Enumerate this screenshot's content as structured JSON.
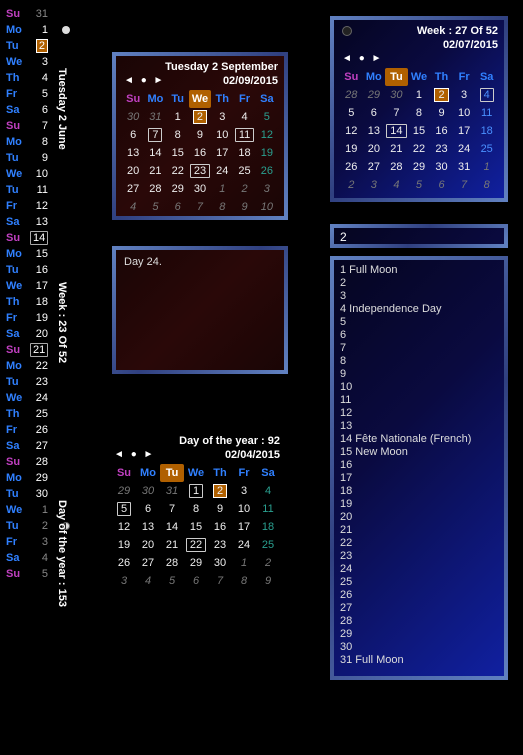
{
  "vertical_list": {
    "label_top": "Tuesday 2 June",
    "label_mid": "Week : 23 Of 52",
    "label_bot": "Day of the year : 153",
    "rows": [
      {
        "dow": "Su",
        "n": "31",
        "cls": "grey"
      },
      {
        "dow": "Mo",
        "n": "1",
        "cls": "white",
        "moon": "full"
      },
      {
        "dow": "Tu",
        "n": "2",
        "cls": "white",
        "mark": "orange"
      },
      {
        "dow": "We",
        "n": "3",
        "cls": "white"
      },
      {
        "dow": "Th",
        "n": "4",
        "cls": "white"
      },
      {
        "dow": "Fr",
        "n": "5",
        "cls": "white"
      },
      {
        "dow": "Sa",
        "n": "6",
        "cls": "white"
      },
      {
        "dow": "Su",
        "n": "7",
        "cls": "white"
      },
      {
        "dow": "Mo",
        "n": "8",
        "cls": "white"
      },
      {
        "dow": "Tu",
        "n": "9",
        "cls": "white"
      },
      {
        "dow": "We",
        "n": "10",
        "cls": "white"
      },
      {
        "dow": "Tu",
        "n": "11",
        "cls": "white"
      },
      {
        "dow": "Fr",
        "n": "12",
        "cls": "white"
      },
      {
        "dow": "Sa",
        "n": "13",
        "cls": "white"
      },
      {
        "dow": "Su",
        "n": "14",
        "cls": "white",
        "mark": "box"
      },
      {
        "dow": "Mo",
        "n": "15",
        "cls": "white"
      },
      {
        "dow": "Tu",
        "n": "16",
        "cls": "white"
      },
      {
        "dow": "We",
        "n": "17",
        "cls": "white"
      },
      {
        "dow": "Th",
        "n": "18",
        "cls": "white"
      },
      {
        "dow": "Fr",
        "n": "19",
        "cls": "white"
      },
      {
        "dow": "Sa",
        "n": "20",
        "cls": "white"
      },
      {
        "dow": "Su",
        "n": "21",
        "cls": "white",
        "mark": "box"
      },
      {
        "dow": "Mo",
        "n": "22",
        "cls": "white"
      },
      {
        "dow": "Tu",
        "n": "23",
        "cls": "white"
      },
      {
        "dow": "We",
        "n": "24",
        "cls": "white"
      },
      {
        "dow": "Th",
        "n": "25",
        "cls": "white"
      },
      {
        "dow": "Fr",
        "n": "26",
        "cls": "white"
      },
      {
        "dow": "Sa",
        "n": "27",
        "cls": "white"
      },
      {
        "dow": "Su",
        "n": "28",
        "cls": "white"
      },
      {
        "dow": "Mo",
        "n": "29",
        "cls": "white"
      },
      {
        "dow": "Tu",
        "n": "30",
        "cls": "white"
      },
      {
        "dow": "We",
        "n": "1",
        "cls": "grey"
      },
      {
        "dow": "Tu",
        "n": "2",
        "cls": "grey",
        "moon": "half"
      },
      {
        "dow": "Fr",
        "n": "3",
        "cls": "grey"
      },
      {
        "dow": "Sa",
        "n": "4",
        "cls": "grey"
      },
      {
        "dow": "Su",
        "n": "5",
        "cls": "grey"
      }
    ]
  },
  "cal_sep": {
    "title1": "Tuesday 2 September",
    "title2": "02/09/2015",
    "hd_hl": "We",
    "rows": [
      [
        {
          "t": "30",
          "c": "grey"
        },
        {
          "t": "31",
          "c": "grey"
        },
        {
          "t": "1",
          "c": "white"
        },
        {
          "t": "2",
          "c": "white",
          "m": "o"
        },
        {
          "t": "3",
          "c": "white"
        },
        {
          "t": "4",
          "c": "white"
        },
        {
          "t": "5",
          "c": "teal"
        }
      ],
      [
        {
          "t": "6",
          "c": "white"
        },
        {
          "t": "7",
          "c": "white",
          "m": "b"
        },
        {
          "t": "8",
          "c": "white"
        },
        {
          "t": "9",
          "c": "white"
        },
        {
          "t": "10",
          "c": "white"
        },
        {
          "t": "11",
          "c": "white",
          "m": "b"
        },
        {
          "t": "12",
          "c": "teal"
        }
      ],
      [
        {
          "t": "13",
          "c": "white"
        },
        {
          "t": "14",
          "c": "white"
        },
        {
          "t": "15",
          "c": "white"
        },
        {
          "t": "16",
          "c": "white"
        },
        {
          "t": "17",
          "c": "white"
        },
        {
          "t": "18",
          "c": "white"
        },
        {
          "t": "19",
          "c": "teal"
        }
      ],
      [
        {
          "t": "20",
          "c": "white"
        },
        {
          "t": "21",
          "c": "white"
        },
        {
          "t": "22",
          "c": "white"
        },
        {
          "t": "23",
          "c": "white",
          "m": "b"
        },
        {
          "t": "24",
          "c": "white"
        },
        {
          "t": "25",
          "c": "white"
        },
        {
          "t": "26",
          "c": "teal"
        }
      ],
      [
        {
          "t": "27",
          "c": "white"
        },
        {
          "t": "28",
          "c": "white"
        },
        {
          "t": "29",
          "c": "white"
        },
        {
          "t": "30",
          "c": "white"
        },
        {
          "t": "1",
          "c": "grey"
        },
        {
          "t": "2",
          "c": "grey"
        },
        {
          "t": "3",
          "c": "grey"
        }
      ],
      [
        {
          "t": "4",
          "c": "grey"
        },
        {
          "t": "5",
          "c": "grey"
        },
        {
          "t": "6",
          "c": "grey"
        },
        {
          "t": "7",
          "c": "grey"
        },
        {
          "t": "8",
          "c": "grey"
        },
        {
          "t": "9",
          "c": "grey"
        },
        {
          "t": "10",
          "c": "grey"
        }
      ]
    ]
  },
  "note_sep": "Day 24.",
  "cal_apr": {
    "title1": "Day of the year : 92",
    "title2": "02/04/2015",
    "hd_hl": "Tu",
    "rows": [
      [
        {
          "t": "29",
          "c": "grey"
        },
        {
          "t": "30",
          "c": "grey"
        },
        {
          "t": "31",
          "c": "grey"
        },
        {
          "t": "1",
          "c": "white",
          "m": "b"
        },
        {
          "t": "2",
          "c": "white",
          "m": "o"
        },
        {
          "t": "3",
          "c": "white"
        },
        {
          "t": "4",
          "c": "teal"
        }
      ],
      [
        {
          "t": "5",
          "c": "white",
          "m": "b"
        },
        {
          "t": "6",
          "c": "white"
        },
        {
          "t": "7",
          "c": "white"
        },
        {
          "t": "8",
          "c": "white"
        },
        {
          "t": "9",
          "c": "white"
        },
        {
          "t": "10",
          "c": "white"
        },
        {
          "t": "11",
          "c": "teal"
        }
      ],
      [
        {
          "t": "12",
          "c": "white"
        },
        {
          "t": "13",
          "c": "white"
        },
        {
          "t": "14",
          "c": "white"
        },
        {
          "t": "15",
          "c": "white"
        },
        {
          "t": "16",
          "c": "white"
        },
        {
          "t": "17",
          "c": "white"
        },
        {
          "t": "18",
          "c": "teal"
        }
      ],
      [
        {
          "t": "19",
          "c": "white"
        },
        {
          "t": "20",
          "c": "white"
        },
        {
          "t": "21",
          "c": "white"
        },
        {
          "t": "22",
          "c": "white",
          "m": "b"
        },
        {
          "t": "23",
          "c": "white"
        },
        {
          "t": "24",
          "c": "white"
        },
        {
          "t": "25",
          "c": "teal"
        }
      ],
      [
        {
          "t": "26",
          "c": "white"
        },
        {
          "t": "27",
          "c": "white"
        },
        {
          "t": "28",
          "c": "white"
        },
        {
          "t": "29",
          "c": "white"
        },
        {
          "t": "30",
          "c": "white"
        },
        {
          "t": "1",
          "c": "grey"
        },
        {
          "t": "2",
          "c": "grey"
        }
      ],
      [
        {
          "t": "3",
          "c": "grey"
        },
        {
          "t": "4",
          "c": "grey"
        },
        {
          "t": "5",
          "c": "grey"
        },
        {
          "t": "6",
          "c": "grey"
        },
        {
          "t": "7",
          "c": "grey"
        },
        {
          "t": "8",
          "c": "grey"
        },
        {
          "t": "9",
          "c": "grey"
        }
      ]
    ]
  },
  "cal_jul": {
    "title1": "Week : 27 Of 52",
    "title2": "02/07/2015",
    "hd_hl": "Tu",
    "rows": [
      [
        {
          "t": "28",
          "c": "grey"
        },
        {
          "t": "29",
          "c": "grey"
        },
        {
          "t": "30",
          "c": "grey"
        },
        {
          "t": "1",
          "c": "white"
        },
        {
          "t": "2",
          "c": "white",
          "m": "o"
        },
        {
          "t": "3",
          "c": "white"
        },
        {
          "t": "4",
          "c": "blue",
          "m": "b"
        }
      ],
      [
        {
          "t": "5",
          "c": "white"
        },
        {
          "t": "6",
          "c": "white"
        },
        {
          "t": "7",
          "c": "white"
        },
        {
          "t": "8",
          "c": "white"
        },
        {
          "t": "9",
          "c": "white"
        },
        {
          "t": "10",
          "c": "white"
        },
        {
          "t": "11",
          "c": "blue"
        }
      ],
      [
        {
          "t": "12",
          "c": "white"
        },
        {
          "t": "13",
          "c": "white"
        },
        {
          "t": "14",
          "c": "white",
          "m": "b"
        },
        {
          "t": "15",
          "c": "white"
        },
        {
          "t": "16",
          "c": "white"
        },
        {
          "t": "17",
          "c": "white"
        },
        {
          "t": "18",
          "c": "blue"
        }
      ],
      [
        {
          "t": "19",
          "c": "white"
        },
        {
          "t": "20",
          "c": "white"
        },
        {
          "t": "21",
          "c": "white"
        },
        {
          "t": "22",
          "c": "white"
        },
        {
          "t": "23",
          "c": "white"
        },
        {
          "t": "24",
          "c": "white"
        },
        {
          "t": "25",
          "c": "blue"
        }
      ],
      [
        {
          "t": "26",
          "c": "white"
        },
        {
          "t": "27",
          "c": "white"
        },
        {
          "t": "28",
          "c": "white"
        },
        {
          "t": "29",
          "c": "white"
        },
        {
          "t": "30",
          "c": "white"
        },
        {
          "t": "31",
          "c": "white"
        },
        {
          "t": "1",
          "c": "grey"
        }
      ],
      [
        {
          "t": "2",
          "c": "grey"
        },
        {
          "t": "3",
          "c": "grey"
        },
        {
          "t": "4",
          "c": "grey"
        },
        {
          "t": "5",
          "c": "grey"
        },
        {
          "t": "6",
          "c": "grey"
        },
        {
          "t": "7",
          "c": "grey"
        },
        {
          "t": "8",
          "c": "grey"
        }
      ]
    ]
  },
  "week_input": "2",
  "events": [
    "1 Full Moon",
    "2",
    "3",
    "4 Independence Day",
    "5",
    "6",
    "7",
    "8",
    "9",
    "10",
    "11",
    "12",
    "13",
    "14 Fête Nationale (French)",
    "15 New Moon",
    "16",
    "17",
    "18",
    "19",
    "20",
    "21",
    "22",
    "23",
    "24",
    "25",
    "26",
    "27",
    "28",
    "29",
    "30",
    "31 Full Moon"
  ],
  "dows": [
    "Su",
    "Mo",
    "Tu",
    "We",
    "Th",
    "Fr",
    "Sa"
  ],
  "nav": {
    "prev": "◄",
    "dot": "●",
    "next": "►"
  }
}
